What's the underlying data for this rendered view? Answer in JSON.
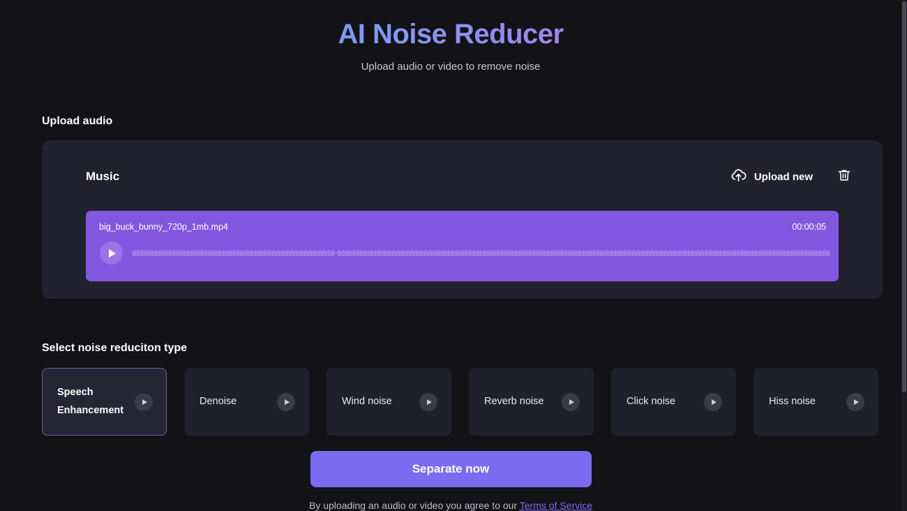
{
  "header": {
    "title": "AI Noise Reducer",
    "subtitle": "Upload audio or video to remove noise"
  },
  "upload_section": {
    "heading": "Upload audio",
    "card_label": "Music",
    "upload_new_label": "Upload new",
    "upload_icon": "cloud-upload-icon",
    "delete_icon": "trash-icon"
  },
  "player": {
    "filename": "big_buck_bunny_720p_1mb.mp4",
    "duration": "00:00:05",
    "play_icon": "play-icon",
    "accent_color": "#8358e0",
    "waveform_color": "#b79bf0"
  },
  "noise_section": {
    "heading": "Select noise reduciton type",
    "options": [
      {
        "label": "Speech Enhancement",
        "selected": true,
        "play_icon": "play-icon"
      },
      {
        "label": "Denoise",
        "selected": false,
        "play_icon": "play-icon"
      },
      {
        "label": "Wind noise",
        "selected": false,
        "play_icon": "play-icon"
      },
      {
        "label": "Reverb noise",
        "selected": false,
        "play_icon": "play-icon"
      },
      {
        "label": "Click noise",
        "selected": false,
        "play_icon": "play-icon"
      },
      {
        "label": "Hiss noise",
        "selected": false,
        "play_icon": "play-icon"
      }
    ],
    "selected_border_color": "#6b5ca8"
  },
  "cta": {
    "label": "Separate now",
    "color": "#7c6bf0"
  },
  "footer": {
    "text_before_link": "By uploading an audio or video you agree to our ",
    "link_label": "Terms of Service",
    "link_color": "#7c6bf0"
  },
  "waveform_bars": [
    8,
    8,
    9,
    8,
    9,
    8,
    8,
    9,
    8,
    8,
    9,
    8,
    8,
    9,
    8,
    8,
    8,
    9,
    8,
    8,
    9,
    8,
    8,
    9,
    8,
    8,
    9,
    8,
    8,
    8,
    9,
    8,
    8,
    9,
    8,
    8,
    9,
    8,
    8,
    9,
    8,
    8,
    8,
    9,
    8,
    8,
    9,
    8,
    8,
    9,
    8,
    8,
    9,
    8,
    8,
    8,
    9,
    8,
    8,
    9,
    8,
    8,
    9,
    8,
    8,
    9,
    8,
    8,
    8,
    9,
    8,
    8,
    9,
    8,
    8,
    9,
    8,
    8,
    9,
    8,
    8,
    8,
    9,
    8,
    8,
    9,
    8,
    8,
    9,
    8,
    8,
    9,
    8,
    8,
    8,
    9,
    8,
    8,
    9,
    8,
    8,
    9,
    8,
    8,
    9,
    8,
    8,
    8,
    9,
    8,
    8,
    9,
    8,
    8,
    9,
    8,
    8,
    9,
    8,
    8,
    8,
    9,
    8,
    8,
    9,
    8,
    8,
    9,
    8,
    8,
    9,
    8,
    8,
    8,
    9,
    8,
    8,
    9,
    8,
    8,
    9,
    8,
    8,
    9,
    8,
    3,
    3,
    8,
    9,
    8,
    8,
    9,
    8,
    8,
    9,
    8,
    8,
    8,
    9,
    8,
    8,
    9,
    8,
    8,
    9,
    8,
    8,
    9,
    8,
    8,
    8,
    9,
    8,
    8,
    9,
    8,
    8,
    9,
    8,
    8,
    9,
    8,
    8,
    8,
    9,
    8,
    8,
    9,
    8,
    8,
    9,
    8,
    8,
    9,
    8,
    8,
    8,
    9,
    8,
    8,
    9,
    8,
    8,
    9,
    8,
    8,
    9,
    8,
    8,
    8,
    9,
    8,
    8,
    9,
    8,
    8,
    9,
    8,
    8,
    9,
    8,
    8,
    8,
    9,
    8,
    8,
    9,
    8,
    8,
    9,
    8,
    8,
    9,
    8,
    8,
    8,
    9,
    8,
    8,
    9,
    8,
    8,
    9,
    8,
    8,
    9,
    8,
    8,
    8,
    9,
    8,
    8,
    9,
    8,
    8,
    9,
    8,
    8,
    9,
    8,
    8,
    8,
    9,
    8,
    8,
    9,
    8,
    8,
    9,
    8,
    8,
    9,
    8,
    8,
    8,
    9,
    8,
    8,
    9,
    8,
    8,
    9,
    8,
    8,
    9,
    8,
    8,
    8,
    9,
    8,
    8,
    9,
    8,
    8,
    9,
    8,
    8,
    9,
    8,
    8,
    8,
    9,
    8,
    8,
    9,
    8,
    8,
    9,
    8,
    8,
    9,
    8,
    8,
    8,
    9,
    8,
    8,
    9,
    8,
    8,
    9,
    8,
    8,
    9,
    8,
    8,
    8,
    9,
    8,
    8,
    9,
    8,
    8,
    9,
    8,
    8,
    9,
    8,
    8,
    8,
    9,
    8,
    8,
    9,
    8,
    8,
    9,
    8,
    8,
    9,
    8,
    8,
    8,
    9,
    8,
    8,
    9,
    8,
    8,
    9,
    8,
    8,
    9,
    8,
    8,
    8,
    9,
    8,
    8,
    9,
    8,
    8,
    9,
    8,
    8,
    9,
    8,
    8,
    8,
    9,
    8,
    8,
    9,
    8,
    8,
    9,
    8,
    8,
    9,
    8,
    8,
    8,
    9,
    8,
    8,
    9,
    8,
    8,
    9,
    8,
    8,
    9,
    8,
    8,
    8,
    9,
    8,
    8,
    9,
    8,
    8,
    9,
    8,
    8,
    9,
    8,
    8,
    8,
    9,
    8,
    8,
    9,
    8,
    8,
    9,
    8,
    8,
    9,
    8,
    8,
    8,
    9,
    8,
    8,
    9,
    8,
    8,
    9,
    8,
    8,
    9,
    8,
    8,
    8,
    9,
    8,
    8,
    9,
    8,
    8,
    9,
    8,
    8,
    9,
    8,
    8,
    8,
    9,
    8,
    8,
    9,
    8,
    8,
    9,
    8,
    8,
    9,
    8,
    8,
    8,
    9,
    8,
    8,
    9,
    8,
    8,
    9,
    8,
    8,
    9,
    8,
    8,
    8,
    9,
    8,
    8,
    9,
    8,
    8,
    9,
    8,
    8,
    9,
    8,
    8,
    8,
    9,
    8,
    8,
    9,
    8,
    8,
    9,
    8,
    8,
    9,
    8,
    8,
    8,
    9,
    8,
    8,
    9,
    8,
    8,
    9,
    8,
    8,
    9,
    8,
    8,
    8,
    9,
    8,
    8,
    9,
    8,
    8,
    9,
    8,
    8,
    9,
    8,
    8,
    8,
    9,
    8,
    8,
    9,
    8,
    8,
    9,
    8,
    8,
    9,
    8,
    8,
    8,
    9,
    8,
    8,
    9,
    8,
    8,
    9,
    8,
    8,
    9,
    8,
    8,
    8,
    9,
    8,
    8,
    9,
    8,
    8,
    9,
    8,
    8,
    9,
    8,
    8,
    8,
    9,
    8,
    8,
    9,
    8,
    8,
    9,
    8,
    8,
    9,
    8,
    8,
    8,
    9,
    8,
    8,
    9,
    8,
    8,
    9,
    8,
    8,
    9,
    8,
    8,
    8,
    4,
    4,
    4,
    4,
    5,
    4,
    4,
    4,
    5,
    4,
    4,
    4,
    4,
    5,
    4,
    4,
    4,
    5,
    4,
    4,
    4,
    4,
    5,
    4,
    4,
    4,
    5,
    4,
    4,
    4,
    4,
    5,
    4,
    4,
    4,
    5,
    4,
    4,
    4,
    4,
    5,
    4,
    4,
    4,
    5,
    4,
    4,
    4,
    4,
    5,
    4,
    4,
    4,
    5,
    4,
    4,
    4,
    4,
    5,
    4,
    4,
    4,
    5,
    4,
    4,
    4,
    4,
    5,
    4,
    4,
    4,
    5,
    4,
    4,
    4,
    4,
    5,
    4,
    4,
    4,
    5,
    4,
    4,
    4,
    4,
    5,
    4,
    4,
    4,
    5,
    4,
    4,
    4,
    4,
    5,
    4,
    4,
    4,
    5,
    4,
    4,
    4,
    4,
    5,
    4,
    4,
    4,
    5,
    4,
    4,
    4,
    4,
    5,
    4,
    4,
    4,
    5,
    4,
    4,
    4,
    4,
    5,
    4,
    4,
    4,
    5,
    4,
    4,
    4,
    4,
    5,
    4,
    4,
    4,
    5,
    4,
    4,
    4,
    4,
    5,
    4,
    4,
    4,
    5,
    4,
    4,
    4,
    4,
    5,
    4,
    4,
    4,
    5,
    4,
    4,
    4,
    4,
    5,
    4,
    4,
    4,
    5,
    4,
    4,
    4,
    4,
    5,
    4,
    4,
    4,
    5,
    4,
    4,
    4,
    4,
    5,
    4,
    4,
    4,
    5,
    4,
    4,
    4,
    4,
    5,
    4,
    4,
    4,
    5,
    4,
    4,
    4,
    4,
    5,
    4,
    4,
    4,
    5,
    4,
    4,
    4,
    4,
    5,
    4,
    4,
    4,
    5,
    4,
    4,
    4,
    4,
    5,
    4,
    4,
    4,
    5,
    4,
    4,
    4,
    4,
    14,
    4,
    4,
    4,
    5,
    4,
    4,
    4,
    4,
    5,
    4,
    4,
    4,
    5,
    4,
    4,
    4,
    4,
    5,
    4,
    4,
    4,
    5,
    4,
    4,
    4,
    4,
    5,
    4,
    4,
    4,
    5,
    4,
    4,
    4,
    4,
    5,
    4,
    4,
    4,
    5,
    4,
    4,
    4,
    4,
    5,
    4,
    4,
    4,
    5,
    4,
    4,
    4,
    4,
    5,
    4,
    4,
    4,
    5,
    4,
    4,
    4,
    4,
    5,
    4,
    4,
    4,
    5,
    4,
    4,
    4,
    4,
    5,
    4,
    4,
    4,
    5,
    4,
    4,
    4,
    4,
    5,
    4,
    4,
    4,
    5,
    4,
    4,
    4,
    4,
    5,
    4,
    4,
    4,
    5,
    4,
    4,
    4,
    4,
    5,
    4,
    4,
    4,
    5,
    4,
    4,
    4,
    4,
    5,
    4,
    4,
    4,
    5,
    4,
    4,
    4,
    4,
    5,
    4,
    4,
    4,
    5,
    4,
    4,
    4,
    4,
    5,
    4,
    4,
    4,
    5,
    4,
    4,
    4,
    4,
    5,
    4,
    4,
    4,
    5,
    18,
    18,
    17,
    18,
    17,
    18,
    6,
    4,
    6,
    4,
    16,
    4,
    6,
    4,
    6,
    4,
    18,
    18,
    18,
    17,
    18,
    18,
    17,
    18,
    18,
    17,
    18,
    18
  ]
}
